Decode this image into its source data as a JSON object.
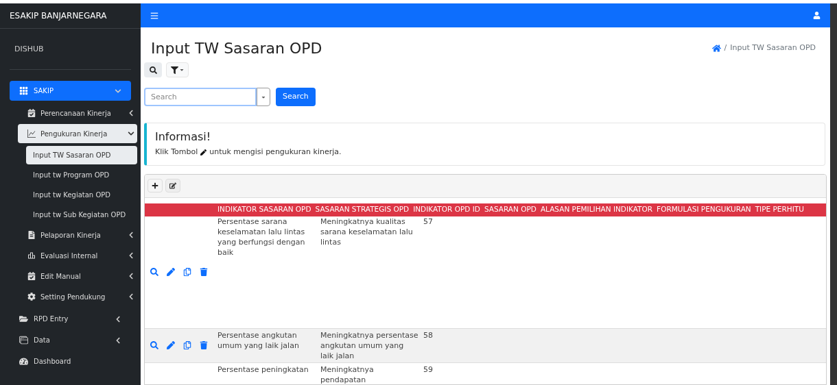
{
  "brand": "ESAKIP BANJARNEGARA",
  "user": "DISHUB",
  "sidebar": {
    "items": [
      {
        "label": "SAKIP",
        "selected": true,
        "expanded": true,
        "children": [
          {
            "label": "Perencanaan Kinerja",
            "selected": false,
            "expanded": false
          },
          {
            "label": "Pengukuran Kinerja",
            "selected": true,
            "expanded": true,
            "children": [
              {
                "label": "Input TW Sasaran OPD",
                "selected": true
              },
              {
                "label": "Input tw Program OPD",
                "selected": false
              },
              {
                "label": "Input tw Kegiatan OPD",
                "selected": false
              },
              {
                "label": "Input tw Sub Kegiatan OPD",
                "selected": false
              }
            ]
          },
          {
            "label": "Pelaporan Kinerja",
            "selected": false,
            "expanded": false
          },
          {
            "label": "Evaluasi Internal",
            "selected": false,
            "expanded": false
          },
          {
            "label": "Edit Manual",
            "selected": false,
            "expanded": false
          },
          {
            "label": "Setting Pendukung",
            "selected": false,
            "expanded": false
          }
        ]
      },
      {
        "label": "RPD Entry",
        "selected": false,
        "expanded": false
      },
      {
        "label": "Data",
        "selected": false,
        "expanded": false
      },
      {
        "label": "Dashboard",
        "selected": false
      }
    ]
  },
  "page": {
    "title": "Input TW Sasaran OPD",
    "breadcrumb_separator": "/",
    "breadcrumb": [
      "Input TW Sasaran OPD"
    ]
  },
  "search": {
    "placeholder": "Search",
    "button": "Search"
  },
  "info": {
    "title": "Informasi!",
    "before": "Klik Tombol",
    "after": "untuk mengisi pengukuran kinerja."
  },
  "table": {
    "columns": [
      "INDIKATOR SASARAN OPD",
      "SASARAN STRATEGIS OPD",
      "INDIKATOR OPD ID",
      "SASARAN OPD",
      "ALASAN PEMILIHAN INDIKATOR",
      "FORMULASI PENGUKURAN",
      "TIPE PERHITU"
    ],
    "rows": [
      {
        "cells": [
          "Persentase sarana keselamatan lalu lintas yang berfungsi dengan baik",
          "Meningkatnya kualitas sarana keselamatan lalu lintas",
          "57"
        ]
      },
      {
        "cells": [
          "Persentase angkutan umum yang laik jalan",
          "Meningkatnya persentase angkutan umum yang laik jalan",
          "58"
        ]
      },
      {
        "cells": [
          "Persentase peningkatan",
          "Meningkatnya pendapatan",
          "59"
        ]
      }
    ]
  }
}
